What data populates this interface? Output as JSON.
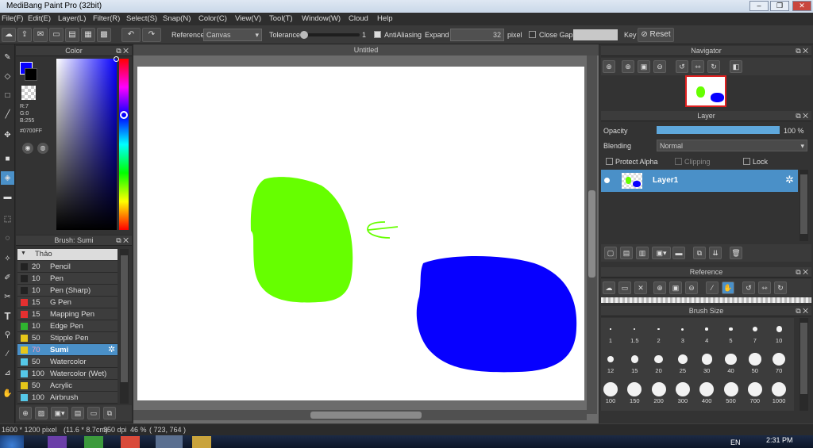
{
  "app": {
    "title": "MediBang Paint Pro (32bit)"
  },
  "menu": [
    "File(F)",
    "Edit(E)",
    "Layer(L)",
    "Filter(R)",
    "Select(S)",
    "Snap(N)",
    "Color(C)",
    "View(V)",
    "Tool(T)",
    "Window(W)",
    "Cloud",
    "Help"
  ],
  "toolbar": {
    "reference_label": "Reference",
    "reference_value": "Canvas",
    "tolerance_label": "Tolerance",
    "tolerance_value": "1",
    "antialiasing_label": "AntiAliasing",
    "expand_label": "Expand",
    "expand_value": "32",
    "expand_unit": "pixel",
    "close_gaps_label": "Close Gaps",
    "key_label": "Key",
    "reset_label": "Reset"
  },
  "color_panel": {
    "title": "Color",
    "r": "R:7",
    "g": "G:0",
    "b": "B:255",
    "hex": "#0700FF",
    "primary_color": "#0700ff",
    "secondary_color": "#000000"
  },
  "brush_panel": {
    "title": "Brush: Sumi",
    "group": "Thảo",
    "brushes": [
      {
        "size": "20",
        "name": "Pencil",
        "color": "#222222"
      },
      {
        "size": "10",
        "name": "Pen",
        "color": "#222222"
      },
      {
        "size": "10",
        "name": "Pen (Sharp)",
        "color": "#222222"
      },
      {
        "size": "15",
        "name": "G Pen",
        "color": "#e53030"
      },
      {
        "size": "15",
        "name": "Mapping Pen",
        "color": "#e53030"
      },
      {
        "size": "10",
        "name": "Edge Pen",
        "color": "#2fb52f"
      },
      {
        "size": "50",
        "name": "Stipple Pen",
        "color": "#e6c619"
      },
      {
        "size": "70",
        "name": "Sumi",
        "color": "#e6c619",
        "selected": true
      },
      {
        "size": "50",
        "name": "Watercolor",
        "color": "#55c8e8"
      },
      {
        "size": "100",
        "name": "Watercolor (Wet)",
        "color": "#55c8e8"
      },
      {
        "size": "50",
        "name": "Acrylic",
        "color": "#e6c619"
      },
      {
        "size": "100",
        "name": "Airbrush",
        "color": "#55c8e8"
      }
    ]
  },
  "canvas": {
    "tab_title": "Untitled",
    "green_shape_color": "#66ff00",
    "blue_shape_color": "#0700ff"
  },
  "navigator": {
    "title": "Navigator"
  },
  "layer_panel": {
    "title": "Layer",
    "opacity_label": "Opacity",
    "opacity_value": "100 %",
    "opacity_fraction": 1.0,
    "blending_label": "Blending",
    "blending_value": "Normal",
    "protect_alpha_label": "Protect Alpha",
    "clipping_label": "Clipping",
    "lock_label": "Lock",
    "layer_name": "Layer1"
  },
  "reference_panel": {
    "title": "Reference"
  },
  "brush_size_panel": {
    "title": "Brush Size",
    "sizes": [
      "1",
      "1.5",
      "2",
      "3",
      "4",
      "5",
      "7",
      "10",
      "12",
      "15",
      "20",
      "25",
      "30",
      "40",
      "50",
      "70",
      "100",
      "150",
      "200",
      "300",
      "400",
      "500",
      "700",
      "1000"
    ]
  },
  "status": {
    "canvas_size": "1600 * 1200 pixel",
    "physical_size": "(11.6 * 8.7cm)",
    "dpi": "350 dpi",
    "zoom": "46 %",
    "cursor": "( 723, 764 )"
  },
  "taskbar": {
    "language": "EN",
    "time": "2:31 PM"
  }
}
